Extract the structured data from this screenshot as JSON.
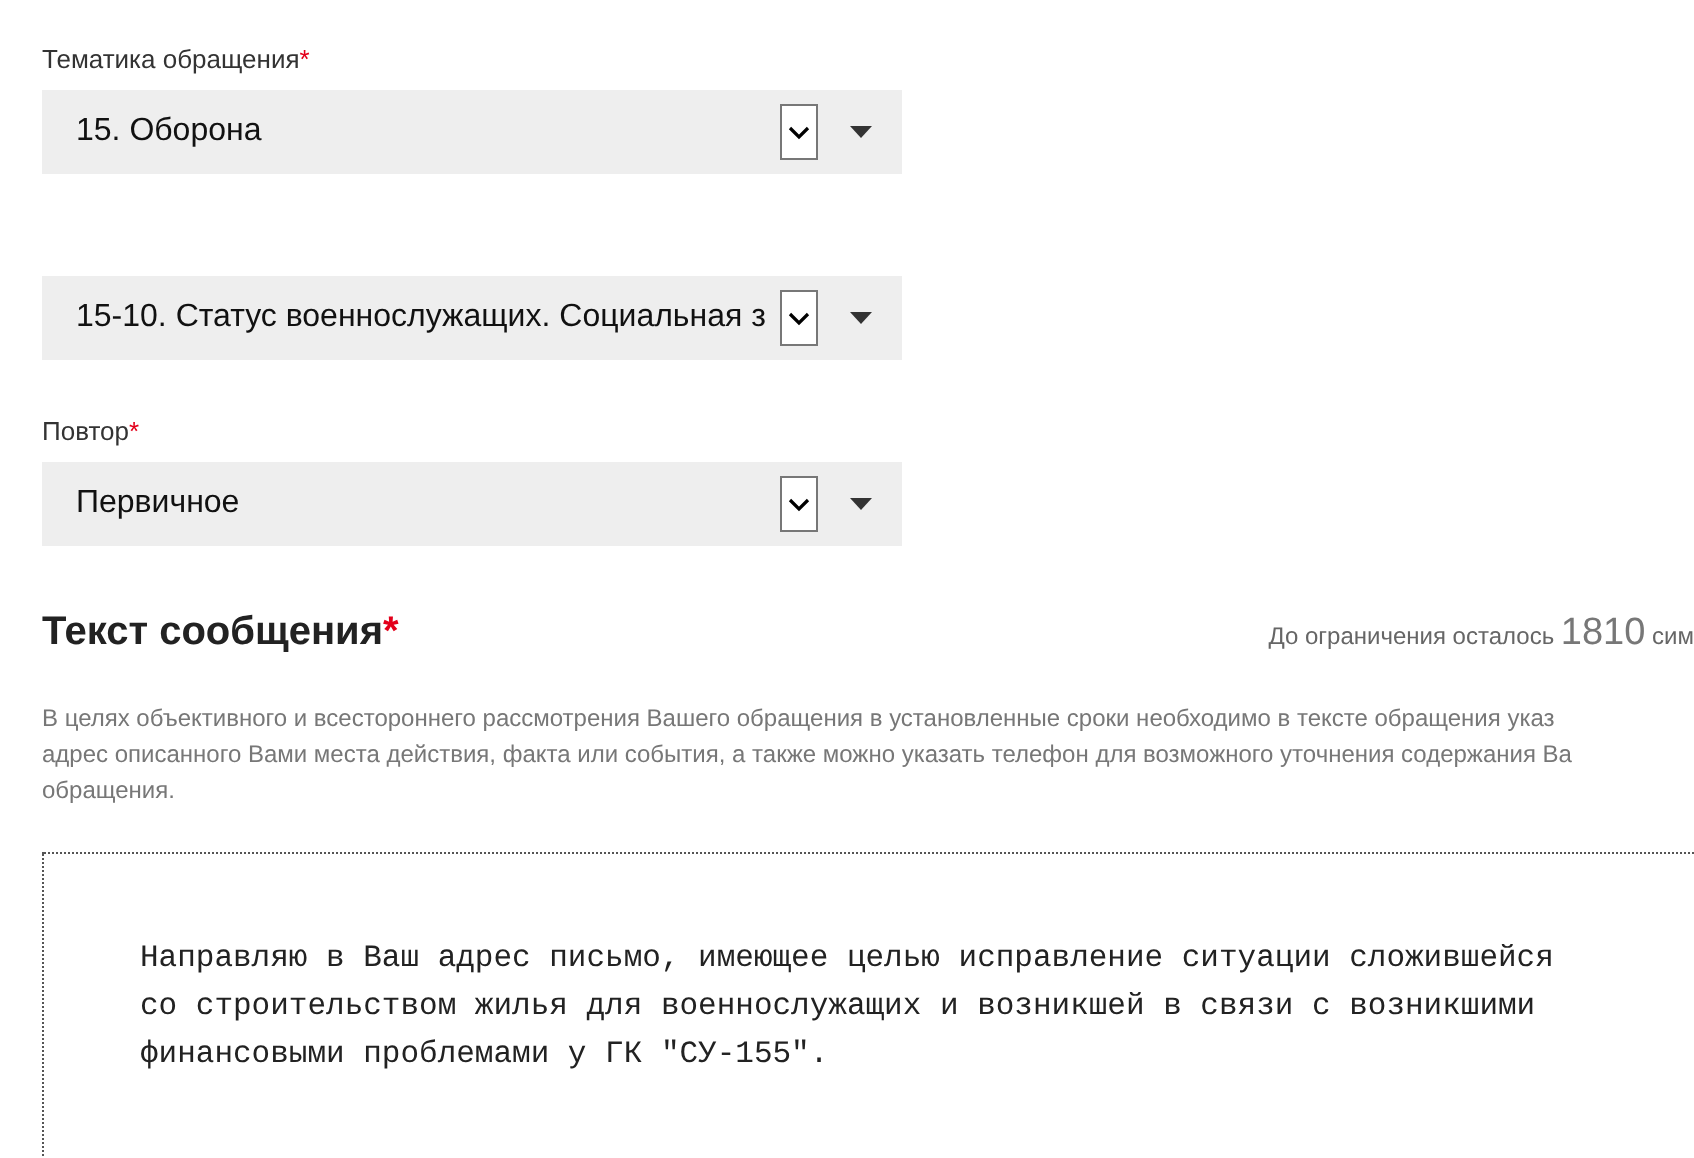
{
  "fields": [
    {
      "label": "Тематика обращения",
      "required_mark": "*",
      "value": "15. Оборона"
    },
    {
      "value": "15-10. Статус военнослужащих. Социальная з"
    },
    {
      "label": "Повтор",
      "required_mark": "*",
      "value": "Первичное"
    }
  ],
  "message": {
    "title": "Текст сообщения",
    "required_mark": "*",
    "counter_prefix": "До ограничения осталось",
    "counter_value": "1810",
    "counter_suffix": "сим",
    "hint_lines": [
      "В целях объективного и всестороннего рассмотрения Вашего обращения в установленные сроки необходимо в тексте обращения указ",
      "адрес описанного Вами места действия, факта или события, а также можно указать телефон для возможного уточнения содержания Ва",
      "обращения."
    ],
    "text_lines": [
      "Направляю в Ваш адрес письмо, имеющее целью исправление ситуации сложившейся",
      "со строительством жилья для военнослужащих и возникшей в связи с возникшими",
      "финансовыми проблемами у ГК \"СУ-155\"."
    ]
  }
}
